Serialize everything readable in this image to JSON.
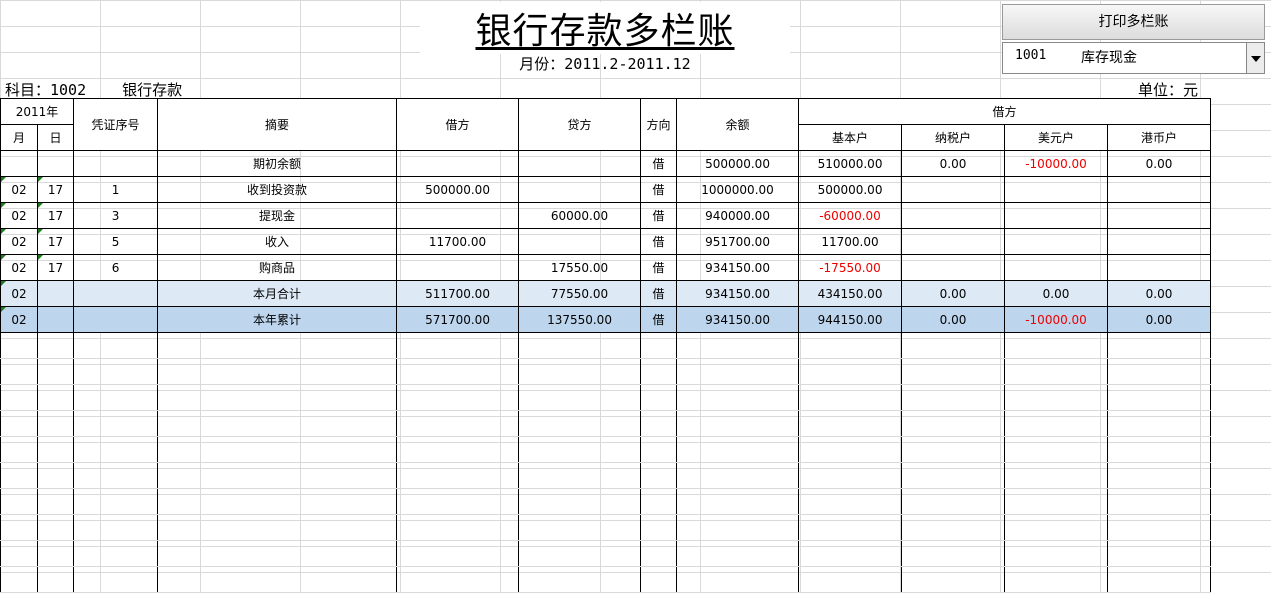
{
  "header": {
    "title": "银行存款多栏账",
    "month_range": "月份：2011.2-2011.12",
    "subject_label": "科目：1002",
    "subject_name": "银行存款",
    "unit": "单位：元"
  },
  "controls": {
    "print_button": "打印多栏账",
    "account_select": {
      "code": "1001",
      "name": "库存现金"
    }
  },
  "table": {
    "year_header": "2011年",
    "headers": {
      "month": "月",
      "day": "日",
      "voucher": "凭证序号",
      "summary": "摘要",
      "debit": "借方",
      "credit": "贷方",
      "direction": "方向",
      "balance": "余额",
      "group_debit": "借方",
      "basic": "基本户",
      "tax": "纳税户",
      "usd": "美元户",
      "hkd": "港币户"
    },
    "rows": [
      {
        "month": "",
        "day": "",
        "voucher": "",
        "summary": "期初余额",
        "debit": "",
        "credit": "",
        "dir": "借",
        "balance": "500000.00",
        "basic": "510000.00",
        "tax": "0.00",
        "usd": "-10000.00",
        "hkd": "0.00"
      },
      {
        "month": "02",
        "day": "17",
        "voucher": "1",
        "summary": "收到投资款",
        "debit": "500000.00",
        "credit": "",
        "dir": "借",
        "balance": "1000000.00",
        "basic": "500000.00",
        "tax": "",
        "usd": "",
        "hkd": ""
      },
      {
        "month": "02",
        "day": "17",
        "voucher": "3",
        "summary": "提现金",
        "debit": "",
        "credit": "60000.00",
        "dir": "借",
        "balance": "940000.00",
        "basic": "-60000.00",
        "tax": "",
        "usd": "",
        "hkd": ""
      },
      {
        "month": "02",
        "day": "17",
        "voucher": "5",
        "summary": "收入",
        "debit": "11700.00",
        "credit": "",
        "dir": "借",
        "balance": "951700.00",
        "basic": "11700.00",
        "tax": "",
        "usd": "",
        "hkd": ""
      },
      {
        "month": "02",
        "day": "17",
        "voucher": "6",
        "summary": "购商品",
        "debit": "",
        "credit": "17550.00",
        "dir": "借",
        "balance": "934150.00",
        "basic": "-17550.00",
        "tax": "",
        "usd": "",
        "hkd": ""
      },
      {
        "month": "02",
        "day": "",
        "voucher": "",
        "summary": "本月合计",
        "debit": "511700.00",
        "credit": "77550.00",
        "dir": "借",
        "balance": "934150.00",
        "basic": "434150.00",
        "tax": "0.00",
        "usd": "0.00",
        "hkd": "0.00"
      },
      {
        "month": "02",
        "day": "",
        "voucher": "",
        "summary": "本年累计",
        "debit": "571700.00",
        "credit": "137550.00",
        "dir": "借",
        "balance": "934150.00",
        "basic": "944150.00",
        "tax": "0.00",
        "usd": "-10000.00",
        "hkd": "0.00"
      }
    ],
    "empty_rows": 10
  }
}
